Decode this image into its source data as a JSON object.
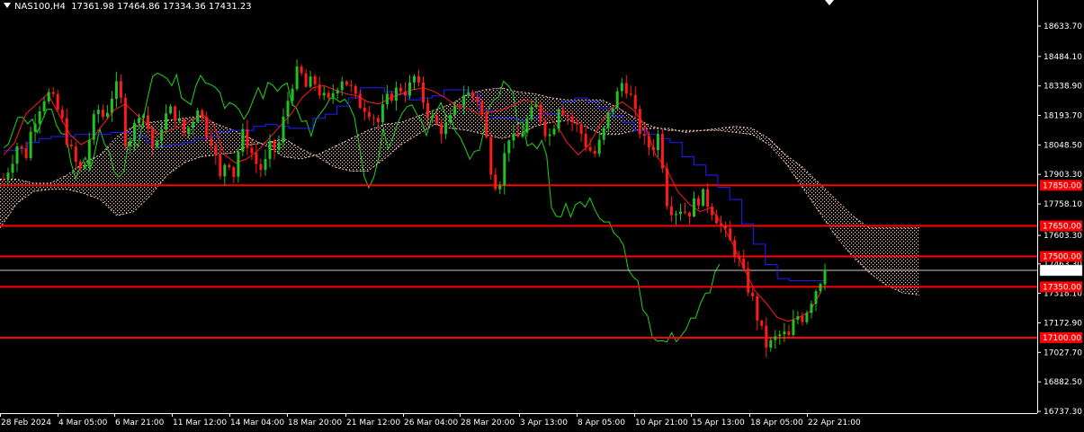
{
  "header": {
    "symbol": "NAS100,H4",
    "ohlc": "17361.98 17464.86 17334.36 17431.23"
  },
  "colors": {
    "background": "#000000",
    "axis": "#ffffff",
    "bull_candle": "#22c022",
    "bear_candle": "#ff1a1a",
    "level_line": "#ff0000",
    "kijun": "#1f1fff",
    "tenkan": "#ff1a1a",
    "chikou": "#1ed41e",
    "cloud": "#f2c9b9",
    "price_line": "#c8c8c8"
  },
  "chart_data": {
    "type": "candlestick",
    "title": "NAS100,H4",
    "ylim": [
      16700,
      18780
    ],
    "y_ticks": [
      18633.7,
      18484.1,
      18338.9,
      18193.7,
      18048.5,
      17903.3,
      17758.1,
      17603.3,
      17463.3,
      17318.1,
      17172.9,
      17027.7,
      16882.5,
      16737.3
    ],
    "y_tick_labels": [
      "18633.70",
      "18484.10",
      "18338.90",
      "18193.70",
      "18048.50",
      "17903.30",
      "17758.10",
      "17603.30",
      "17463.30",
      "17318.10",
      "17172.90",
      "17027.70",
      "16882.50",
      "16737.30"
    ],
    "x_tick_labels": [
      "28 Feb 2024",
      "4 Mar 05:00",
      "6 Mar 21:00",
      "11 Mar 12:00",
      "14 Mar 04:00",
      "18 Mar 20:00",
      "21 Mar 12:00",
      "26 Mar 04:00",
      "28 Mar 20:00",
      "3 Apr 13:00",
      "8 Apr 05:00",
      "10 Apr 21:00",
      "15 Apr 13:00",
      "18 Apr 05:00",
      "22 Apr 21:00"
    ],
    "horizontal_levels": [
      {
        "value": 17850.0,
        "label": "17850.00"
      },
      {
        "value": 17650.0,
        "label": "17650.00"
      },
      {
        "value": 17500.0,
        "label": "17500.00"
      },
      {
        "value": 17350.0,
        "label": "17350.00"
      },
      {
        "value": 17100.0,
        "label": "17100.00"
      }
    ],
    "current_price": {
      "value": 17431.23,
      "label": "17431.23"
    },
    "last_bar": {
      "open": 17361.98,
      "high": 17464.86,
      "low": 17334.36,
      "close": 17431.23
    },
    "close_path": [
      17880,
      17960,
      18060,
      17980,
      18150,
      18240,
      18310,
      18260,
      18180,
      18050,
      17960,
      17900,
      18100,
      18230,
      18180,
      18290,
      18350,
      18050,
      18120,
      18240,
      18140,
      17990,
      18160,
      18220,
      18190,
      18100,
      18150,
      18250,
      18120,
      18070,
      17870,
      18000,
      17900,
      18110,
      18050,
      17960,
      17920,
      18040,
      18020,
      18200,
      18350,
      18420,
      18330,
      18370,
      18300,
      18250,
      18330,
      18380,
      18340,
      18260,
      18240,
      18210,
      18160,
      18260,
      18300,
      18330,
      18310,
      18380,
      18290,
      18200,
      18150,
      18120,
      18170,
      18240,
      18310,
      18290,
      18270,
      18080,
      17860,
      17880,
      18100,
      18060,
      18120,
      18190,
      18240,
      18130,
      18090,
      18250,
      18210,
      18160,
      18120,
      18040,
      18000,
      18080,
      18200,
      18280,
      18370,
      18290,
      18150,
      18060,
      18030,
      18110,
      17780,
      17720,
      17740,
      17710,
      17770,
      17800,
      17750,
      17690,
      17620,
      17560,
      17480,
      17380,
      17280,
      17150,
      17050,
      17090,
      17120,
      17100,
      17210,
      17200,
      17280,
      17360,
      17431.23
    ],
    "kijun_path": [
      18020,
      18030,
      18060,
      18080,
      18090,
      18090,
      18100,
      18100,
      18100,
      18110,
      18110,
      18090,
      18060,
      18040,
      18050,
      18060,
      18080,
      18090,
      18110,
      18120,
      18120,
      18140,
      18150,
      18140,
      18130,
      18130,
      18180,
      18200,
      18240,
      18280,
      18330,
      18330,
      18310,
      18300,
      18270,
      18280,
      18290,
      18320,
      18320,
      18300,
      18220,
      18180,
      18180,
      18170,
      18180,
      18200,
      18200,
      18260,
      18280,
      18260,
      18230,
      18190,
      18160,
      18120,
      18100,
      18080,
      18060,
      17990,
      17950,
      17900,
      17840,
      17780,
      17660,
      17560,
      17460,
      17390,
      17380,
      17380,
      17380,
      17370
    ],
    "tenkan_path": [
      18000,
      18060,
      18200,
      18250,
      18300,
      18200,
      18100,
      18050,
      18080,
      18150,
      18220,
      18250,
      18200,
      18150,
      18100,
      18120,
      18140,
      18170,
      18200,
      18150,
      18000,
      17960,
      17980,
      18020,
      18080,
      18140,
      18200,
      18280,
      18330,
      18340,
      18320,
      18300,
      18290,
      18260,
      18250,
      18280,
      18300,
      18320,
      18330,
      18310,
      18280,
      18240,
      18230,
      18200,
      18210,
      18220,
      18240,
      18270,
      18260,
      18210,
      18150,
      18060,
      18000,
      18050,
      18150,
      18230,
      18260,
      18220,
      18150,
      18000,
      17930,
      17820,
      17760,
      17720,
      17740,
      17660,
      17560,
      17440,
      17330,
      17270,
      17200,
      17180,
      17200,
      17230,
      17330
    ]
  }
}
